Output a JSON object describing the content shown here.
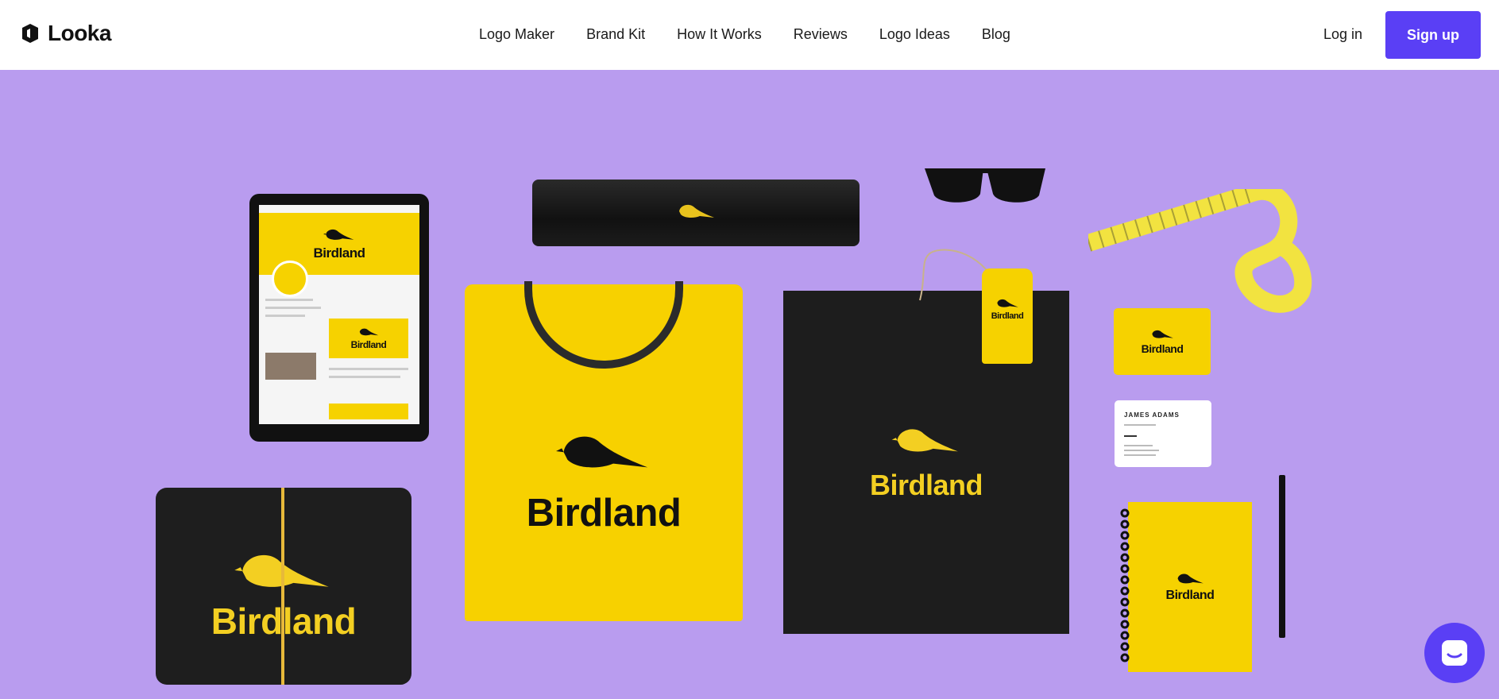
{
  "nav": {
    "logo_text": "Looka",
    "links": [
      "Logo Maker",
      "Brand Kit",
      "How It Works",
      "Reviews",
      "Logo Ideas",
      "Blog"
    ],
    "login": "Log in",
    "signup": "Sign up"
  },
  "hero": {
    "brand_name": "Birdland",
    "card_name": "JAMES ADAMS"
  },
  "colors": {
    "accent": "#5a3ff5",
    "hero_bg": "#b99cef",
    "brand_yellow": "#f6d200",
    "brand_dark": "#1d1d1d"
  },
  "icons": {
    "logo": "looka-logo-icon",
    "chat": "chat-icon",
    "bird": "bird-icon"
  }
}
